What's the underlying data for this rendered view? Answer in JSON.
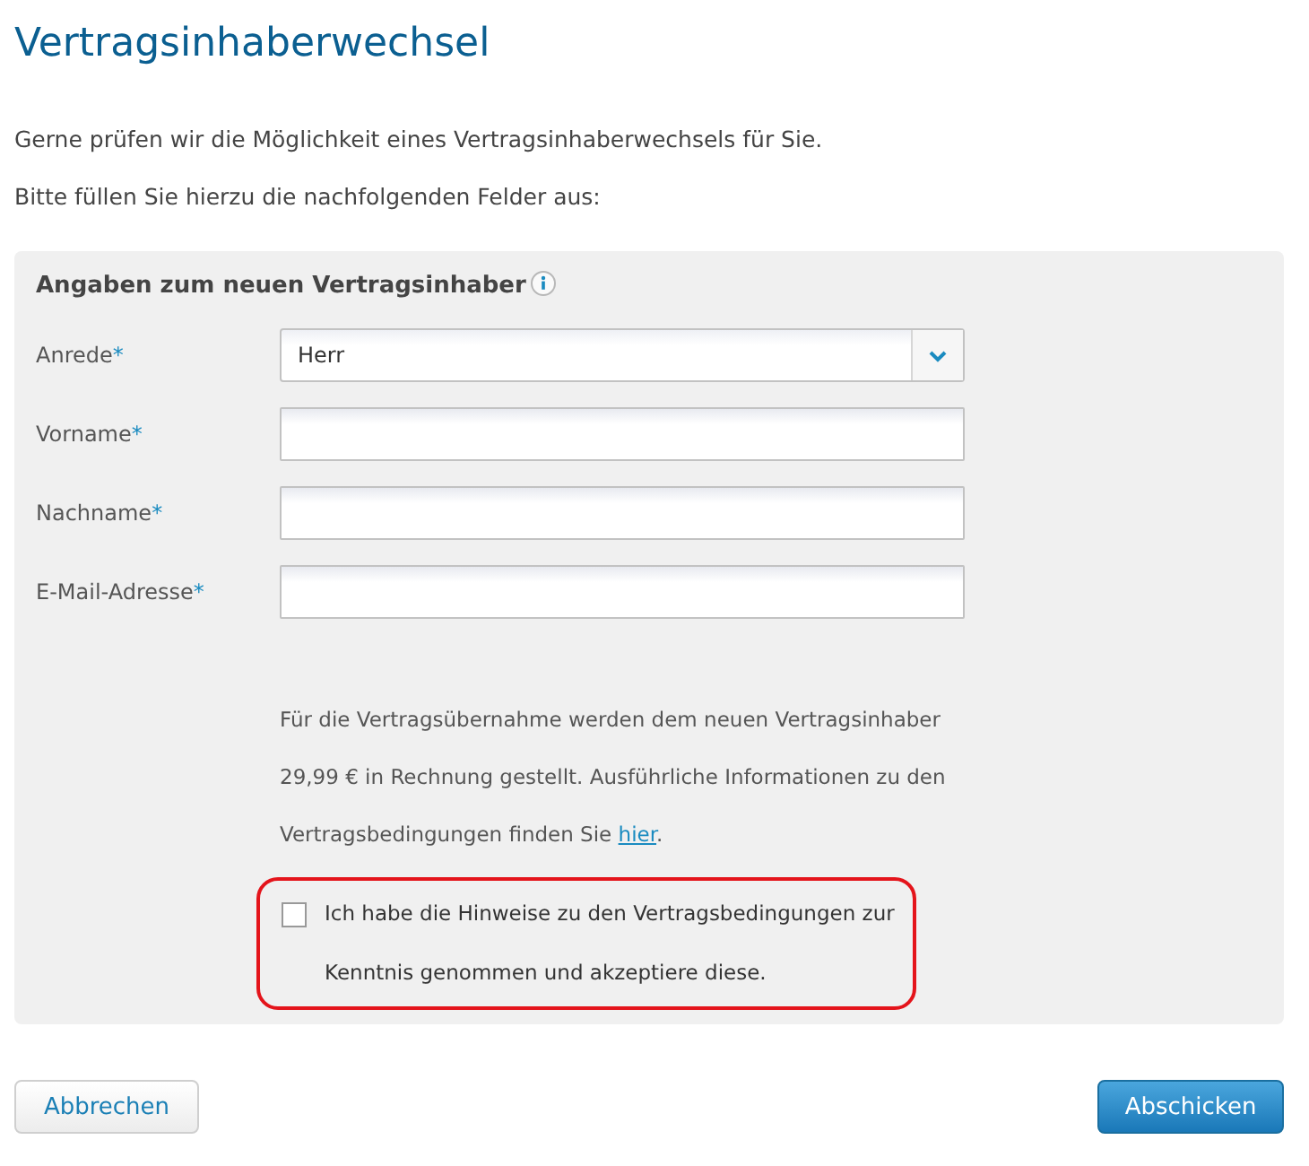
{
  "title": "Vertragsinhaberwechsel",
  "intro": [
    "Gerne prüfen wir die Möglichkeit eines Vertragsinhaberwechsels für Sie.",
    "Bitte füllen Sie hierzu die nachfolgenden Felder aus:"
  ],
  "panel": {
    "heading": "Angaben zum neuen Vertragsinhaber",
    "fields": [
      {
        "kind": "select",
        "label": "Anrede",
        "mark": "*",
        "value": "Herr"
      },
      {
        "kind": "text",
        "label": "Vorname",
        "mark": "*"
      },
      {
        "kind": "text",
        "label": "Nachname",
        "mark": "*"
      },
      {
        "kind": "text",
        "label": "E-Mail-Adresse",
        "mark": "*"
      }
    ],
    "info": {
      "before": "Für die Vertragsübernahme werden dem neuen Vertragsinhaber 29,99 € in Rechnung gestellt. Ausführliche Informationen zu den Vertragsbedingungen finden Sie ",
      "link": "hier",
      "after": "."
    },
    "consent": {
      "label": "Ich habe die Hinweise zu den Vertragsbedingungen zur Kenntnis genommen und akzeptiere diese.",
      "checked": false,
      "highlighted": true
    }
  },
  "buttons": [
    {
      "kind": "secondary",
      "label": "Abbrechen"
    },
    {
      "kind": "primary",
      "label": "Abschicken"
    }
  ]
}
